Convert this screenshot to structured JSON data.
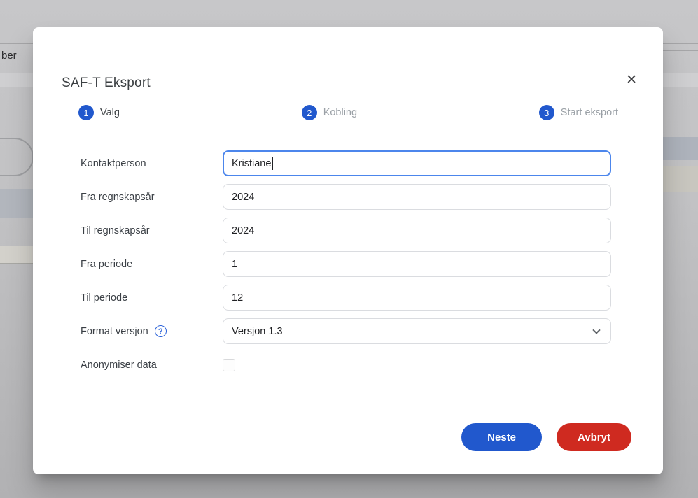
{
  "background": {
    "partial_text": "ber"
  },
  "modal": {
    "title": "SAF-T Eksport",
    "close_glyph": "✕",
    "help_glyph": "?",
    "stepper": [
      {
        "number": "1",
        "label": "Valg",
        "state": "active"
      },
      {
        "number": "2",
        "label": "Kobling",
        "state": "inactive"
      },
      {
        "number": "3",
        "label": "Start eksport",
        "state": "inactive"
      }
    ],
    "fields": [
      {
        "label": "Kontaktperson",
        "value": "Kristiane"
      },
      {
        "label": "Fra regnskapsår",
        "value": "2024"
      },
      {
        "label": "Til regnskapsår",
        "value": "2024"
      },
      {
        "label": "Fra periode",
        "value": "1"
      },
      {
        "label": "Til periode",
        "value": "12"
      },
      {
        "label": "Format versjon",
        "value": "Versjon 1.3"
      },
      {
        "label": "Anonymiser data",
        "checked": false
      }
    ],
    "buttons": {
      "next": "Neste",
      "cancel": "Avbryt"
    }
  },
  "colors": {
    "accent_blue": "#2158cd",
    "danger_red": "#cf2a20",
    "focus_border": "#4c86ec",
    "input_border": "#dadce0",
    "inactive_step_label": "#9aa0a6"
  }
}
